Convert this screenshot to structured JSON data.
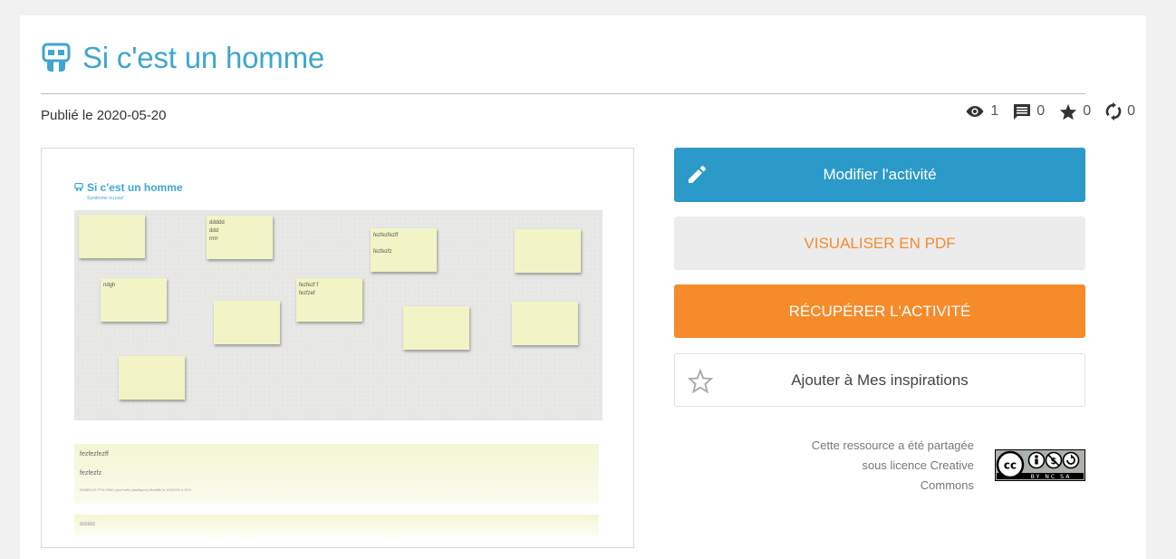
{
  "page": {
    "title": "Si c'est un homme",
    "published": "Publié le 2020-05-20"
  },
  "stats": {
    "views": "1",
    "comments": "0",
    "stars": "0",
    "reshares": "0"
  },
  "preview": {
    "title": "Si c'est un homme",
    "subtitle": "Syndrome ou pas!",
    "notes": [
      {
        "text": ""
      },
      {
        "text": "ddddd\nddd\nrrrrr"
      },
      {
        "text": "fezfezfezff\n\nfezfezfz"
      },
      {
        "text": ""
      },
      {
        "text": "ndgh"
      },
      {
        "text": "fezfezf f\nfezfzef"
      },
      {
        "text": ""
      },
      {
        "text": ""
      },
      {
        "text": ""
      },
      {
        "text": ""
      }
    ],
    "list_item_1": "fezfezfezff",
    "list_item_2": "fezfezfz",
    "list_item_author": "ISABELLE POLONIO (prof arts plastiques) Modifié le 19/20/20 à 15:9",
    "list_item_3": "ddddd"
  },
  "actions": {
    "edit": "Modifier l'activité",
    "pdf": "Visualiser en PDF",
    "get": "Récupérer l'activité",
    "inspiration": "Ajouter à Mes inspirations"
  },
  "license": {
    "line1": "Cette ressource a été partagée",
    "line2": "sous licence Creative",
    "line3": "Commons",
    "badge_text": "BY NC SA"
  },
  "colors": {
    "accent_blue": "#2b9ac8",
    "title_blue": "#3ea6cf",
    "orange": "#f68b2b"
  }
}
